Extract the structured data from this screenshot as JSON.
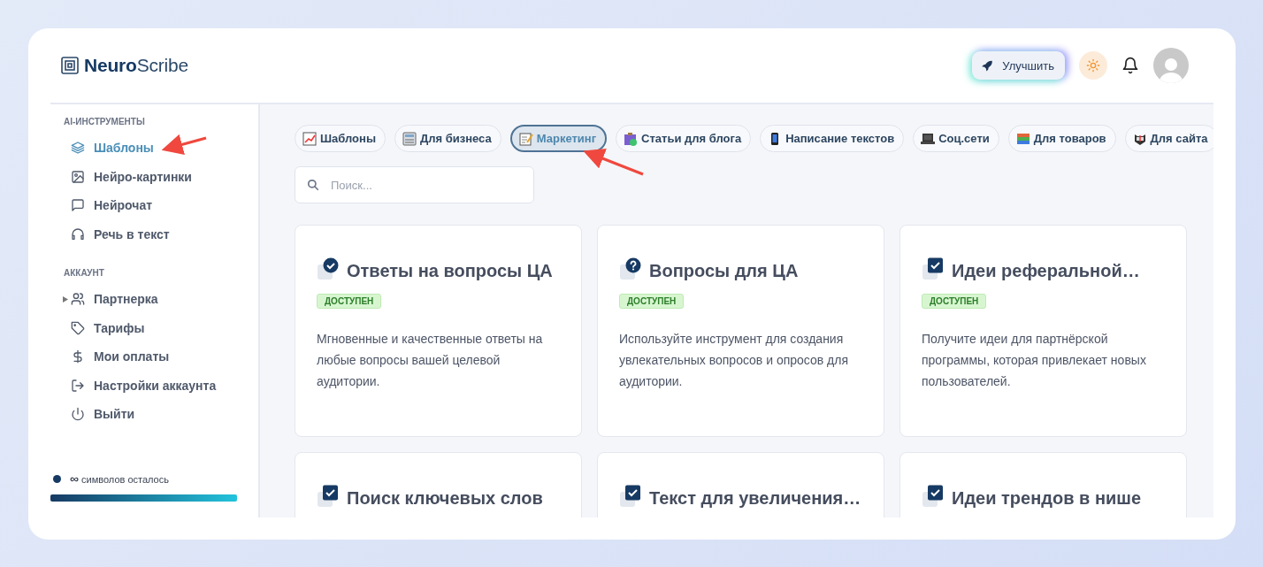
{
  "brand": {
    "name": "**Neuro**Scribe"
  },
  "header": {
    "upgrade_button": "Улучшить"
  },
  "sidebar": {
    "sections": [
      {
        "title": "AI-ИНСТРУМЕНТЫ",
        "items": [
          {
            "label": "Шаблоны",
            "selected": true
          },
          {
            "label": "Нейро-картинки",
            "selected": false
          },
          {
            "label": "Нейрочат",
            "selected": false
          },
          {
            "label": "Речь в текст",
            "selected": false
          }
        ]
      },
      {
        "title": "АККАУНТ",
        "items": [
          {
            "label": "Партнерка",
            "selected": false,
            "expanded": false
          },
          {
            "label": "Тарифы",
            "selected": false
          },
          {
            "label": "Мои оплаты",
            "selected": false
          },
          {
            "label": "Настройки аккаунта",
            "selected": false
          },
          {
            "label": "Выйти",
            "selected": false
          }
        ]
      }
    ],
    "quota": {
      "symbol": "∞",
      "label": "символов осталось",
      "level": 1
    }
  },
  "categories": [
    {
      "label": "Шаблоны",
      "selected": false
    },
    {
      "label": "Для бизнеса",
      "selected": false
    },
    {
      "label": "Маркетинг",
      "selected": true
    },
    {
      "label": "Статьи для блога",
      "selected": false
    },
    {
      "label": "Написание текстов",
      "selected": false
    },
    {
      "label": "Соц.сети",
      "selected": false
    },
    {
      "label": "Для товаров",
      "selected": false
    },
    {
      "label": "Для сайта",
      "selected": false
    }
  ],
  "search": {
    "placeholder": "Поиск..."
  },
  "templates": [
    {
      "kind": "circle-check",
      "title": "Ответы на вопросы ЦА",
      "badge": "ДОСТУПЕН",
      "description": "Мгновенные и качественные ответы на любые вопросы вашей целевой аудитории."
    },
    {
      "kind": "question",
      "title": "Вопросы для ЦА",
      "badge": "ДОСТУПЕН",
      "description": "Используйте инструмент для создания увлекательных вопросов и опросов для аудитории."
    },
    {
      "kind": "square-check",
      "title": "Идеи реферальной…",
      "badge": "ДОСТУПЕН",
      "description": "Получите идеи для партнёрской программы, которая привлекает новых пользователей."
    },
    {
      "kind": "square-check",
      "title": "Поиск ключевых слов"
    },
    {
      "kind": "square-check",
      "title": "Текст для увеличения…"
    },
    {
      "kind": "square-check",
      "title": "Идеи трендов в нише"
    }
  ]
}
